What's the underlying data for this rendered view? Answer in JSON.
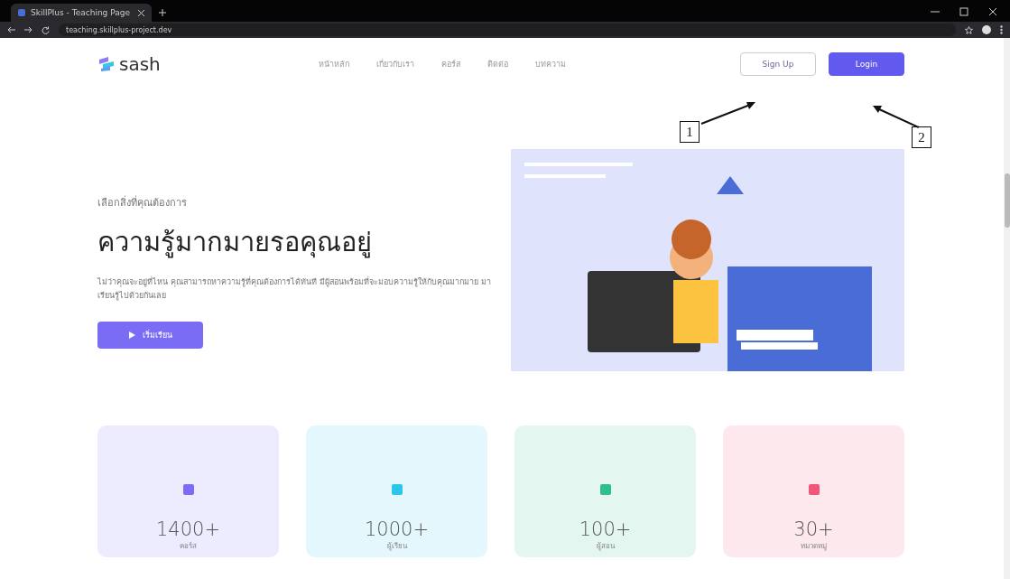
{
  "browser": {
    "tab_title": "SkillPlus - Teaching Page",
    "url": "teaching.skillplus-project.dev"
  },
  "header": {
    "logo": "sash",
    "nav": [
      {
        "label": "หน้าหลัก"
      },
      {
        "label": "เกี่ยวกับเรา"
      },
      {
        "label": "คอร์ส"
      },
      {
        "label": "ติดต่อ"
      },
      {
        "label": "บทความ"
      }
    ],
    "buttons": [
      {
        "label": "Sign Up",
        "kind": "outline"
      },
      {
        "label": "Login",
        "kind": "primary"
      }
    ]
  },
  "annotations": [
    {
      "label": "1"
    },
    {
      "label": "2"
    }
  ],
  "hero": {
    "eyebrow": "เลือกสิ่งที่คุณต้องการ",
    "title": "ความรู้มากมายรอคุณอยู่",
    "text": "ไม่ว่าคุณจะอยู่ที่ไหน คุณสามารถหาความรู้ที่คุณต้องการได้ทันที มีผู้สอนพร้อมที่จะมอบความรู้ให้กับคุณมากมาย มาเรียนรู้ไปด้วยกันเลย",
    "button": "เริ่มเรียน"
  },
  "stats": [
    {
      "value": "1400+",
      "label": "คอร์ส",
      "color": "#7b6cf6"
    },
    {
      "value": "1000+",
      "label": "ผู้เรียน",
      "color": "#2cc6e8"
    },
    {
      "value": "100+",
      "label": "ผู้สอน",
      "color": "#2fbf8f"
    },
    {
      "value": "30+",
      "label": "หมวดหมู่",
      "color": "#f0557a"
    }
  ]
}
